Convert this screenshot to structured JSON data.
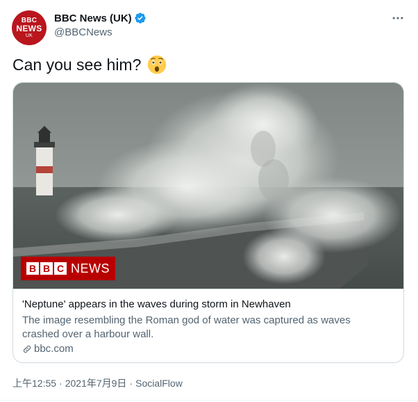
{
  "author": {
    "avatar_text": [
      "BBC",
      "NEWS",
      "UK"
    ],
    "display_name": "BBC News (UK)",
    "handle": "@BBCNews",
    "verified": true
  },
  "tweet": {
    "text": "Can you see him?",
    "emoji": "astonished-face"
  },
  "card": {
    "banner_letters": [
      "B",
      "B",
      "C"
    ],
    "banner_word": "NEWS",
    "title": "'Neptune' appears in the waves during storm in Newhaven",
    "description": "The image resembling the Roman god of water was captured as waves crashed over a harbour wall.",
    "domain": "bbc.com"
  },
  "meta": {
    "time": "上午12:55",
    "date": "2021年7月9日",
    "source": "SocialFlow",
    "separator": "·"
  },
  "colors": {
    "bbc_red": "#b80000",
    "verified_blue": "#1d9bf0",
    "text_primary": "#0f1419",
    "text_secondary": "#536471",
    "border": "#cfd9de"
  },
  "icons": {
    "more": "more-horizontal-icon",
    "verified": "verified-badge-icon",
    "link": "link-icon"
  }
}
